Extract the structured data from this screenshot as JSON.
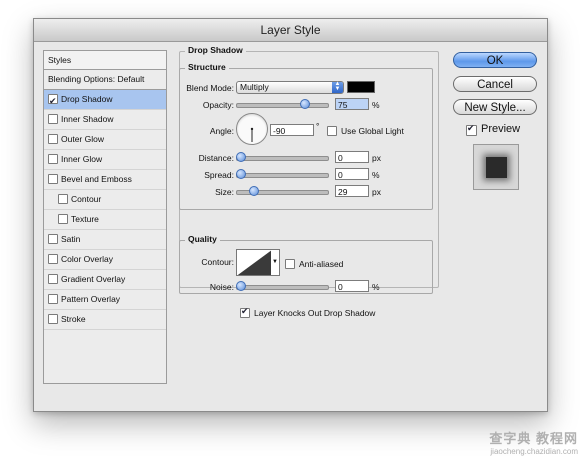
{
  "window": {
    "title": "Layer Style"
  },
  "styles_panel": {
    "header": "Styles",
    "blending": "Blending Options: Default",
    "items": [
      {
        "label": "Drop Shadow",
        "checked": true,
        "selected": true,
        "sub": false
      },
      {
        "label": "Inner Shadow",
        "checked": false,
        "selected": false,
        "sub": false
      },
      {
        "label": "Outer Glow",
        "checked": false,
        "selected": false,
        "sub": false
      },
      {
        "label": "Inner Glow",
        "checked": false,
        "selected": false,
        "sub": false
      },
      {
        "label": "Bevel and Emboss",
        "checked": false,
        "selected": false,
        "sub": false
      },
      {
        "label": "Contour",
        "checked": false,
        "selected": false,
        "sub": true
      },
      {
        "label": "Texture",
        "checked": false,
        "selected": false,
        "sub": true
      },
      {
        "label": "Satin",
        "checked": false,
        "selected": false,
        "sub": false
      },
      {
        "label": "Color Overlay",
        "checked": false,
        "selected": false,
        "sub": false
      },
      {
        "label": "Gradient Overlay",
        "checked": false,
        "selected": false,
        "sub": false
      },
      {
        "label": "Pattern Overlay",
        "checked": false,
        "selected": false,
        "sub": false
      },
      {
        "label": "Stroke",
        "checked": false,
        "selected": false,
        "sub": false
      }
    ]
  },
  "drop_shadow": {
    "title": "Drop Shadow",
    "structure": {
      "title": "Structure",
      "blend_mode_label": "Blend Mode:",
      "blend_mode_value": "Multiply",
      "shadow_color": "#000000",
      "opacity_label": "Opacity:",
      "opacity_value": "75",
      "opacity_unit": "%",
      "opacity_slider": 75,
      "angle_label": "Angle:",
      "angle_value": "-90",
      "angle_unit": "°",
      "global_light_label": "Use Global Light",
      "global_light_checked": false,
      "distance_label": "Distance:",
      "distance_value": "0",
      "distance_unit": "px",
      "spread_label": "Spread:",
      "spread_value": "0",
      "spread_unit": "%",
      "size_label": "Size:",
      "size_value": "29",
      "size_unit": "px"
    },
    "quality": {
      "title": "Quality",
      "contour_label": "Contour:",
      "anti_aliased_label": "Anti-aliased",
      "anti_aliased_checked": false,
      "noise_label": "Noise:",
      "noise_value": "0",
      "noise_unit": "%"
    },
    "knockout_label": "Layer Knocks Out Drop Shadow",
    "knockout_checked": true
  },
  "buttons": {
    "ok": "OK",
    "cancel": "Cancel",
    "new_style": "New Style...",
    "preview_label": "Preview",
    "preview_checked": true
  },
  "watermark": {
    "main": "查字典 教程网",
    "sub": "jiaocheng.chazidian.com"
  },
  "colors": {
    "selection": "#a8c5ef",
    "default_button": "#5e98ea",
    "dialog_bg": "#e8e8e8"
  }
}
